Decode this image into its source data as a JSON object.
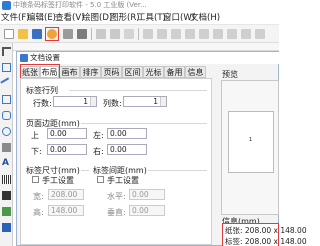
{
  "app": {
    "title": "中琅条码标签打印软件 - 5.0 工业版 (Ver..."
  },
  "menu": [
    "文件(F)",
    "编辑(E)",
    "查看(V)",
    "绘图(D)",
    "图形(R)",
    "工具(T)",
    "窗口(W)",
    "文档(H)"
  ],
  "dialog": {
    "title": "文档设置",
    "tabs": [
      "纸张",
      "布局",
      "画布",
      "排序",
      "页码",
      "区间",
      "光标",
      "备用",
      "信息"
    ],
    "active_tab": "布局",
    "label_rows_cols": {
      "group_label": "标签行列",
      "rows_label": "行数:",
      "rows_value": "1",
      "cols_label": "列数:",
      "cols_value": "1"
    },
    "margins": {
      "group_label": "页面边距(mm)",
      "top_label": "上",
      "top_value": "0.00",
      "left_label": "左:",
      "left_value": "0.00",
      "bottom_label": "下:",
      "bottom_value": "0.00",
      "right_label": "右:",
      "right_value": "0.00"
    },
    "label_size": {
      "group_label": "标签尺寸(mm)",
      "manual_label": "手工设置",
      "width_label": "宽:",
      "width_value": "208.00",
      "height_label": "高:",
      "height_value": "148.00"
    },
    "label_spacing": {
      "group_label": "标签间距(mm)",
      "manual_label": "手工设置",
      "horizontal_label": "水平:",
      "horizontal_value": "0.00",
      "vertical_label": "垂直:",
      "vertical_value": "0.00"
    },
    "preview": {
      "label": "预览",
      "page_number": "1"
    },
    "info": {
      "label": "信息(mm)",
      "paper_line": "纸张: 208.00 x 148.00",
      "label_line": "标签: 208.00 x 148.00"
    }
  }
}
